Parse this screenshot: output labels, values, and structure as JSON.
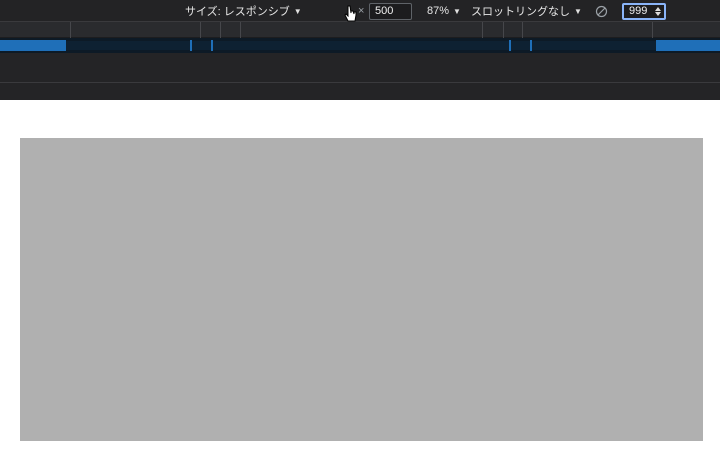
{
  "device_toolbar": {
    "size_label": "サイズ: レスポンシブ",
    "width_value": "999",
    "times_symbol": "×",
    "height_value": "500",
    "zoom_label": "87%",
    "throttle_label": "スロットリングなし",
    "caret_glyph": "▼",
    "rotate_icon": "rotate-icon",
    "accent_color": "#8ab4f8",
    "background_color": "#232325"
  },
  "media_queries": {
    "active_color": "#1f6fb8",
    "bar_color": "#0d1a26"
  },
  "viewport": {
    "background_color": "#ffffff",
    "content_color": "#b0b0b0"
  }
}
